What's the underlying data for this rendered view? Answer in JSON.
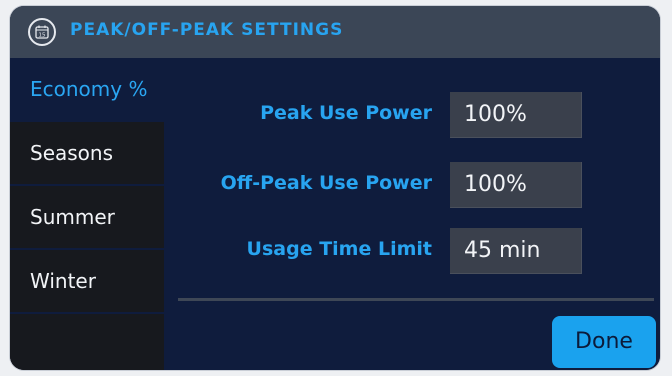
{
  "titlebar": {
    "icon": "calendar-icon",
    "icon_day": "15",
    "title": "PEAK/OFF-PEAK SETTINGS"
  },
  "sidebar": {
    "items": [
      {
        "label": "Economy %",
        "active": true
      },
      {
        "label": "Seasons",
        "active": false
      },
      {
        "label": "Summer",
        "active": false
      },
      {
        "label": "Winter",
        "active": false
      }
    ]
  },
  "settings": {
    "peak_use_power": {
      "label": "Peak Use Power",
      "value": "100%"
    },
    "off_peak_use_power": {
      "label": "Off-Peak Use Power",
      "value": "100%"
    },
    "usage_time_limit": {
      "label": "Usage Time Limit",
      "value": "45 min"
    }
  },
  "actions": {
    "done_label": "Done"
  },
  "colors": {
    "accent": "#28a4f0",
    "background": "#0f1c3d",
    "titlebar": "#3b4656",
    "sidebar": "#17191e",
    "field": "#3a404c",
    "button": "#1aa2ee"
  }
}
